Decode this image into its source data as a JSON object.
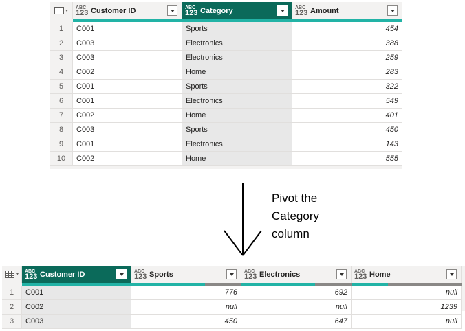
{
  "top_table": {
    "columns": [
      {
        "type_top": "ABC",
        "type_bottom": "123",
        "name": "Customer ID",
        "selected": false,
        "quality_pct": 100
      },
      {
        "type_top": "ABC",
        "type_bottom": "123",
        "name": "Category",
        "selected": true,
        "quality_pct": 100
      },
      {
        "type_top": "ABC",
        "type_bottom": "123",
        "name": "Amount",
        "selected": false,
        "quality_pct": 100
      }
    ],
    "rows": [
      {
        "n": "1",
        "customer": "C001",
        "category": "Sports",
        "amount": "454"
      },
      {
        "n": "2",
        "customer": "C003",
        "category": "Electronics",
        "amount": "388"
      },
      {
        "n": "3",
        "customer": "C003",
        "category": "Electronics",
        "amount": "259"
      },
      {
        "n": "4",
        "customer": "C002",
        "category": "Home",
        "amount": "283"
      },
      {
        "n": "5",
        "customer": "C001",
        "category": "Sports",
        "amount": "322"
      },
      {
        "n": "6",
        "customer": "C001",
        "category": "Electronics",
        "amount": "549"
      },
      {
        "n": "7",
        "customer": "C002",
        "category": "Home",
        "amount": "401"
      },
      {
        "n": "8",
        "customer": "C003",
        "category": "Sports",
        "amount": "450"
      },
      {
        "n": "9",
        "customer": "C001",
        "category": "Electronics",
        "amount": "143"
      },
      {
        "n": "10",
        "customer": "C002",
        "category": "Home",
        "amount": "555"
      }
    ]
  },
  "annotation": {
    "lines": [
      "Pivot the",
      "Category",
      "column"
    ]
  },
  "bottom_table": {
    "columns": [
      {
        "type_top": "ABC",
        "type_bottom": "123",
        "name": "Customer ID",
        "selected": true,
        "quality_pct": 100
      },
      {
        "type_top": "ABC",
        "type_bottom": "123",
        "name": "Sports",
        "selected": false,
        "quality_pct": 67
      },
      {
        "type_top": "ABC",
        "type_bottom": "123",
        "name": "Electronics",
        "selected": false,
        "quality_pct": 67
      },
      {
        "type_top": "ABC",
        "type_bottom": "123",
        "name": "Home",
        "selected": false,
        "quality_pct": 33
      }
    ],
    "rows": [
      {
        "n": "1",
        "customer": "C001",
        "sports": "776",
        "electronics": "692",
        "home": "null"
      },
      {
        "n": "2",
        "customer": "C002",
        "sports": "null",
        "electronics": "null",
        "home": "1239"
      },
      {
        "n": "3",
        "customer": "C003",
        "sports": "450",
        "electronics": "647",
        "home": "null"
      }
    ]
  },
  "colors": {
    "selected_header": "#0b6a5a",
    "quality_valid": "#22b3a6",
    "quality_empty": "#8a8886"
  }
}
